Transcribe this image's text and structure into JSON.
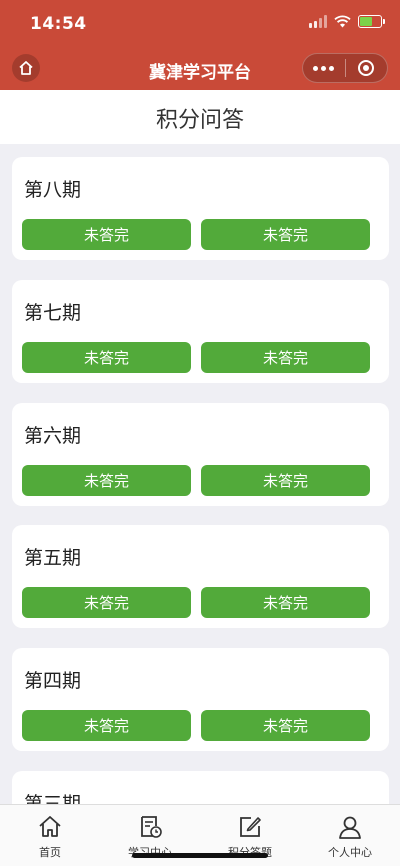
{
  "status_bar": {
    "time": "14:54"
  },
  "nav": {
    "title": "冀津学习平台"
  },
  "page": {
    "title": "积分问答"
  },
  "periods": [
    {
      "title": "第八期",
      "buttons": [
        "未答完",
        "未答完"
      ]
    },
    {
      "title": "第七期",
      "buttons": [
        "未答完",
        "未答完"
      ]
    },
    {
      "title": "第六期",
      "buttons": [
        "未答完",
        "未答完"
      ]
    },
    {
      "title": "第五期",
      "buttons": [
        "未答完",
        "未答完"
      ]
    },
    {
      "title": "第四期",
      "buttons": [
        "未答完",
        "未答完"
      ]
    },
    {
      "title": "第三期",
      "buttons": []
    }
  ],
  "tabs": [
    {
      "label": "首页",
      "icon": "home-icon"
    },
    {
      "label": "学习中心",
      "icon": "study-center-icon"
    },
    {
      "label": "积分答题",
      "icon": "edit-icon"
    },
    {
      "label": "个人中心",
      "icon": "user-icon"
    }
  ],
  "colors": {
    "nav_bg": "#c94a38",
    "button_green": "#52aa3a",
    "page_bg": "#efeff4"
  }
}
